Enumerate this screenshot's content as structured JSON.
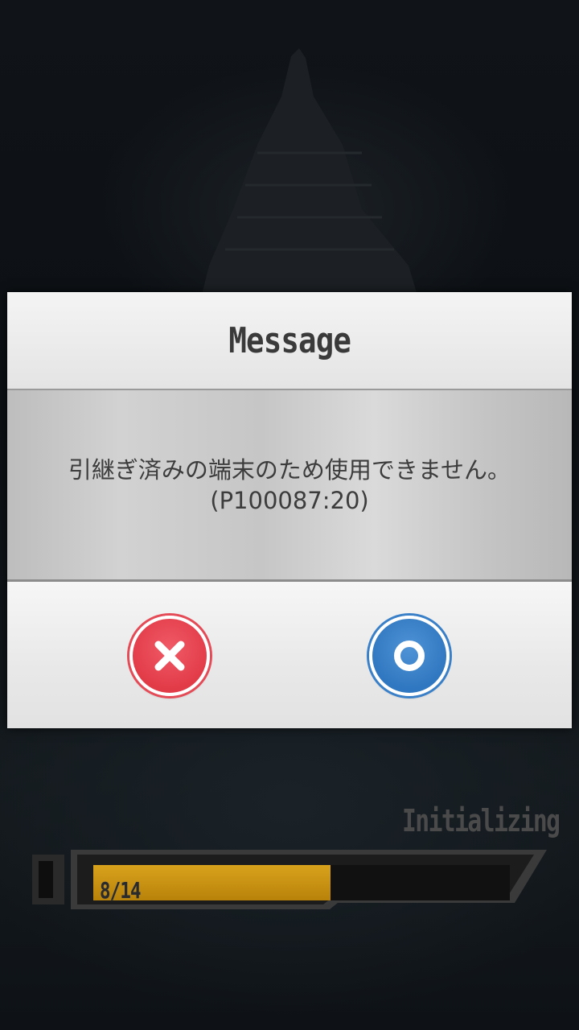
{
  "dialog": {
    "title": "Message",
    "message_line1": "引継ぎ済みの端末のため使用できません。",
    "message_line2": "(P100087:20)",
    "cancel_icon": "x-icon",
    "ok_icon": "circle-icon"
  },
  "loading": {
    "status": "Initializing",
    "count": "8/14",
    "progress": 0.57
  },
  "colors": {
    "cancel": "#e23b48",
    "ok": "#2f77c0",
    "progress_fill": "#c9920f"
  }
}
